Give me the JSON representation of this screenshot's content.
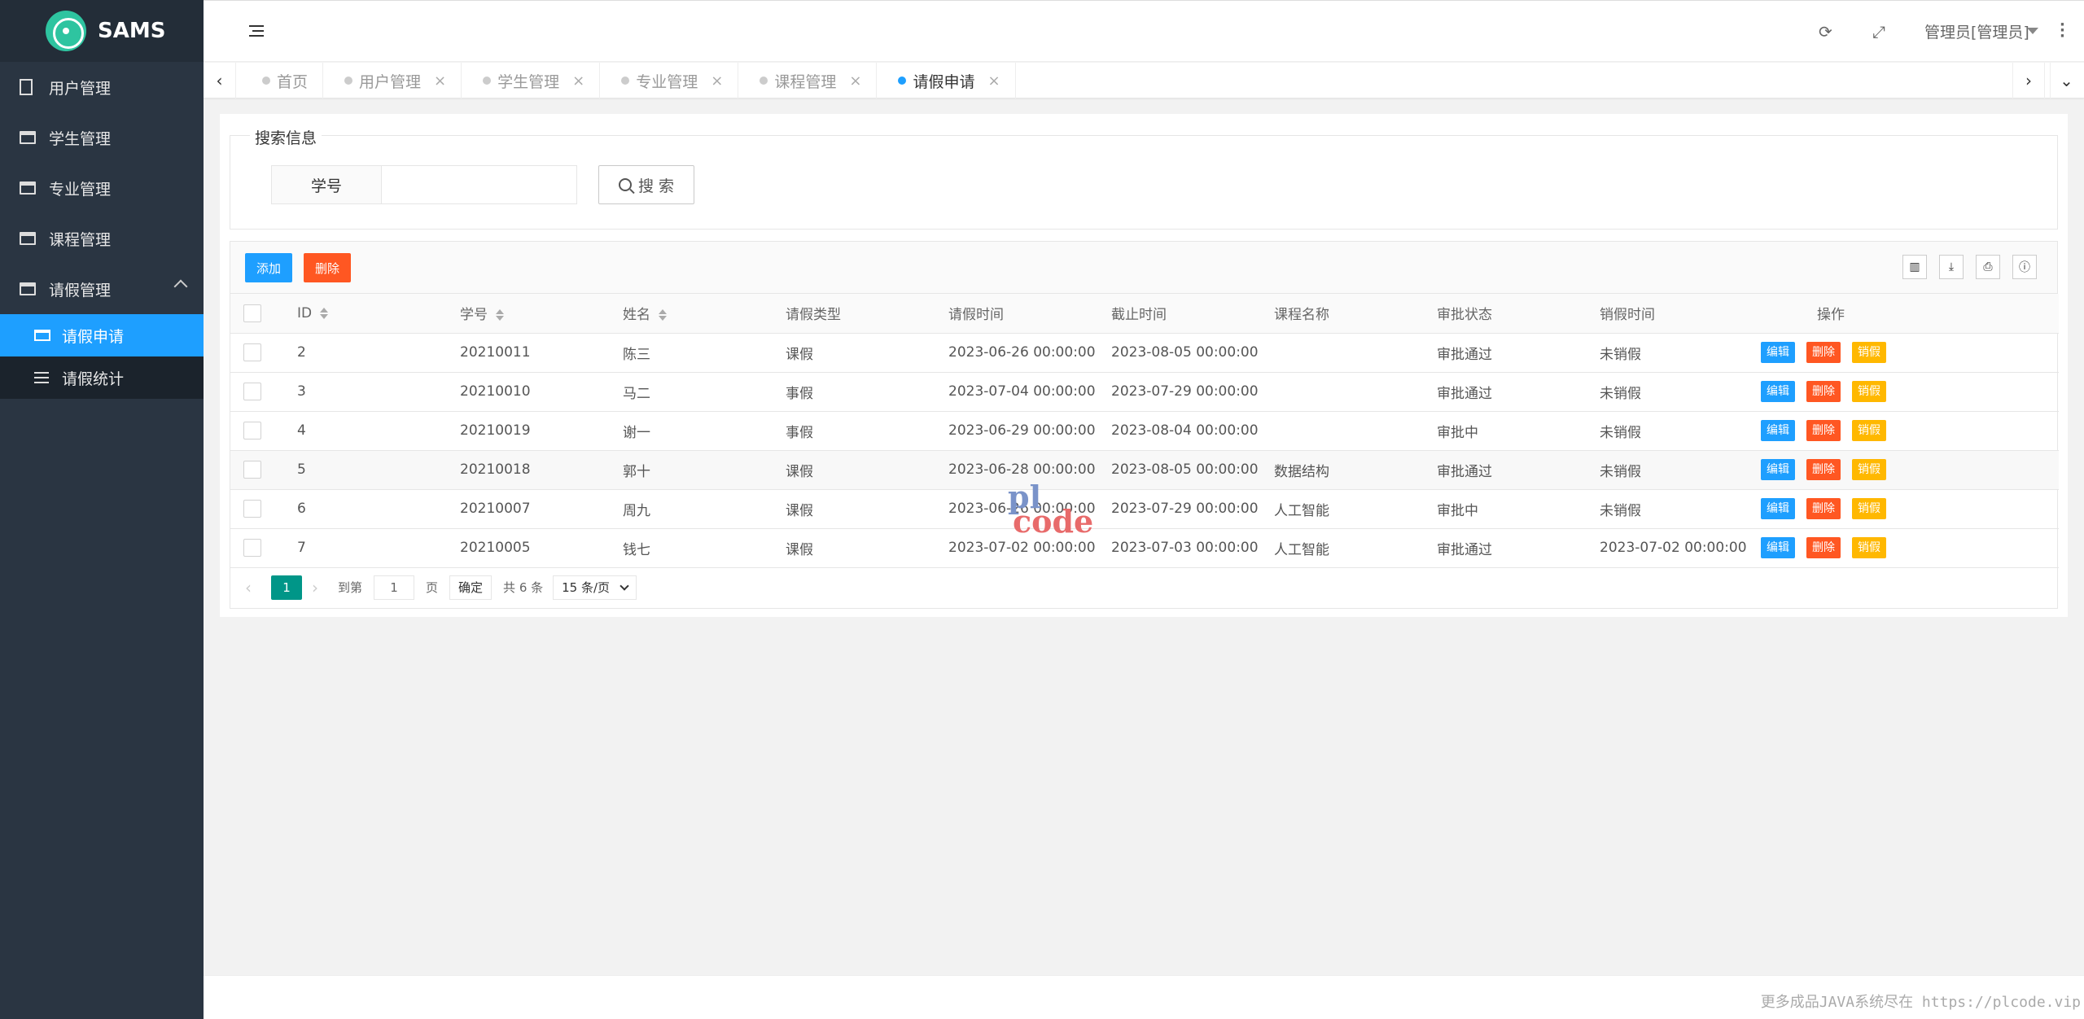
{
  "app": {
    "title": "SAMS"
  },
  "sidebar": {
    "items": [
      {
        "label": "用户管理"
      },
      {
        "label": "学生管理"
      },
      {
        "label": "专业管理"
      },
      {
        "label": "课程管理"
      },
      {
        "label": "请假管理"
      }
    ],
    "subitems": [
      {
        "label": "请假申请",
        "active": true
      },
      {
        "label": "请假统计"
      }
    ]
  },
  "header": {
    "user": "管理员[管理员]",
    "icons": [
      "menu-toggle-icon",
      "refresh-icon",
      "fullscreen-icon",
      "more-icon"
    ]
  },
  "tabs": [
    {
      "label": "首页",
      "closable": false
    },
    {
      "label": "用户管理",
      "closable": true
    },
    {
      "label": "学生管理",
      "closable": true
    },
    {
      "label": "专业管理",
      "closable": true
    },
    {
      "label": "课程管理",
      "closable": true
    },
    {
      "label": "请假申请",
      "closable": true,
      "active": true
    }
  ],
  "search": {
    "legend": "搜索信息",
    "field_label": "学号",
    "field_value": "",
    "button": "搜 索"
  },
  "toolbar": {
    "add": "添加",
    "delete": "删除"
  },
  "table": {
    "headers": [
      "ID",
      "学号",
      "姓名",
      "请假类型",
      "请假时间",
      "截止时间",
      "课程名称",
      "审批状态",
      "销假时间",
      "操作"
    ],
    "rows": [
      [
        "2",
        "20210011",
        "陈三",
        "课假",
        "2023-06-26 00:00:00",
        "2023-08-05 00:00:00",
        "",
        "审批通过",
        "未销假"
      ],
      [
        "3",
        "20210010",
        "马二",
        "事假",
        "2023-07-04 00:00:00",
        "2023-07-29 00:00:00",
        "",
        "审批通过",
        "未销假"
      ],
      [
        "4",
        "20210019",
        "谢一",
        "事假",
        "2023-06-29 00:00:00",
        "2023-08-04 00:00:00",
        "",
        "审批中",
        "未销假"
      ],
      [
        "5",
        "20210018",
        "郭十",
        "课假",
        "2023-06-28 00:00:00",
        "2023-08-05 00:00:00",
        "数据结构",
        "审批通过",
        "未销假"
      ],
      [
        "6",
        "20210007",
        "周九",
        "课假",
        "2023-06-26 00:00:00",
        "2023-07-29 00:00:00",
        "人工智能",
        "审批中",
        "未销假"
      ],
      [
        "7",
        "20210005",
        "钱七",
        "课假",
        "2023-07-02 00:00:00",
        "2023-07-03 00:00:00",
        "人工智能",
        "审批通过",
        "2023-07-02 00:00:00"
      ]
    ],
    "actions": [
      "编辑",
      "删除",
      "销假"
    ]
  },
  "pager": {
    "current": "1",
    "goto_label": "到第",
    "goto_value": "1",
    "page_unit": "页",
    "confirm": "确定",
    "total": "共 6 条",
    "page_size": "15 条/页"
  },
  "footer": {
    "text": "更多成品JAVA系统尽在 https://plcode.vip"
  },
  "watermark": {
    "line1": "pl",
    "line2": "code"
  }
}
